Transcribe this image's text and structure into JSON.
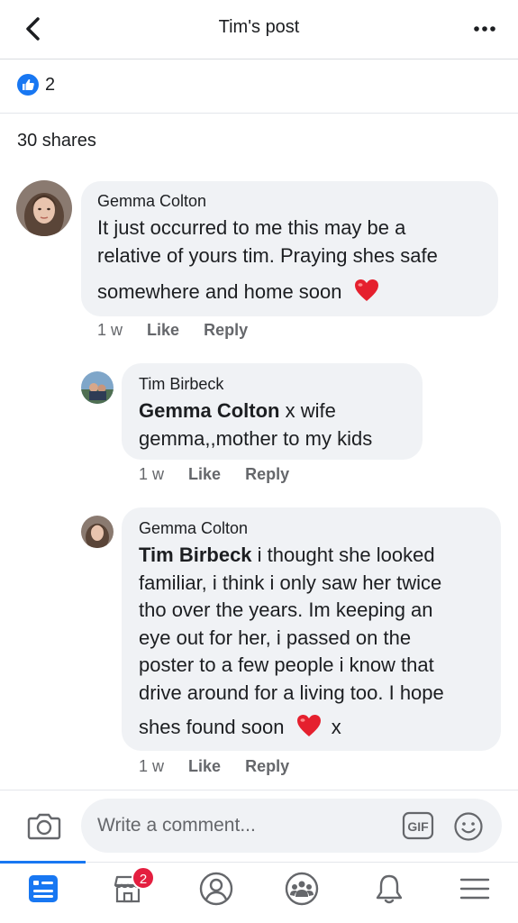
{
  "header": {
    "title": "Tim's post"
  },
  "reactions": {
    "like_count": "2"
  },
  "shares": {
    "label": "30 shares"
  },
  "comments": [
    {
      "author": "Gemma Colton",
      "lines": [
        "It just occurred to me this may be a",
        "relative of yours tim. Praying shes safe",
        "somewhere and home soon"
      ],
      "time": "1 w",
      "like": "Like",
      "reply": "Reply"
    },
    {
      "author": "Tim Birbeck",
      "tag": "Gemma Colton",
      "lines": [
        " x wife",
        "gemma,,mother to my kids"
      ],
      "time": "1 w",
      "like": "Like",
      "reply": "Reply"
    },
    {
      "author": "Gemma Colton",
      "tag": "Tim Birbeck",
      "lines": [
        " i thought she looked",
        "familiar, i think i only saw her twice",
        "tho over the years. Im keeping an",
        "eye out for her, i passed on the",
        "poster to a few people i know that",
        "drive around for a living too. I hope",
        "shes found soon",
        "x"
      ],
      "time": "1 w",
      "like": "Like",
      "reply": "Reply"
    }
  ],
  "composer": {
    "placeholder": "Write a comment..."
  },
  "tabbar": {
    "marketplace_badge": "2"
  },
  "colors": {
    "accent": "#1877f2",
    "bubble": "#f0f2f5",
    "badge": "#e41e3f",
    "heart": "#e5202e"
  },
  "icons": [
    "back-icon",
    "more-icon",
    "like-icon",
    "heart-emoji",
    "camera-icon",
    "gif-icon",
    "emoji-icon",
    "news-feed-icon",
    "marketplace-icon",
    "profile-icon",
    "groups-icon",
    "bell-icon",
    "menu-icon"
  ]
}
